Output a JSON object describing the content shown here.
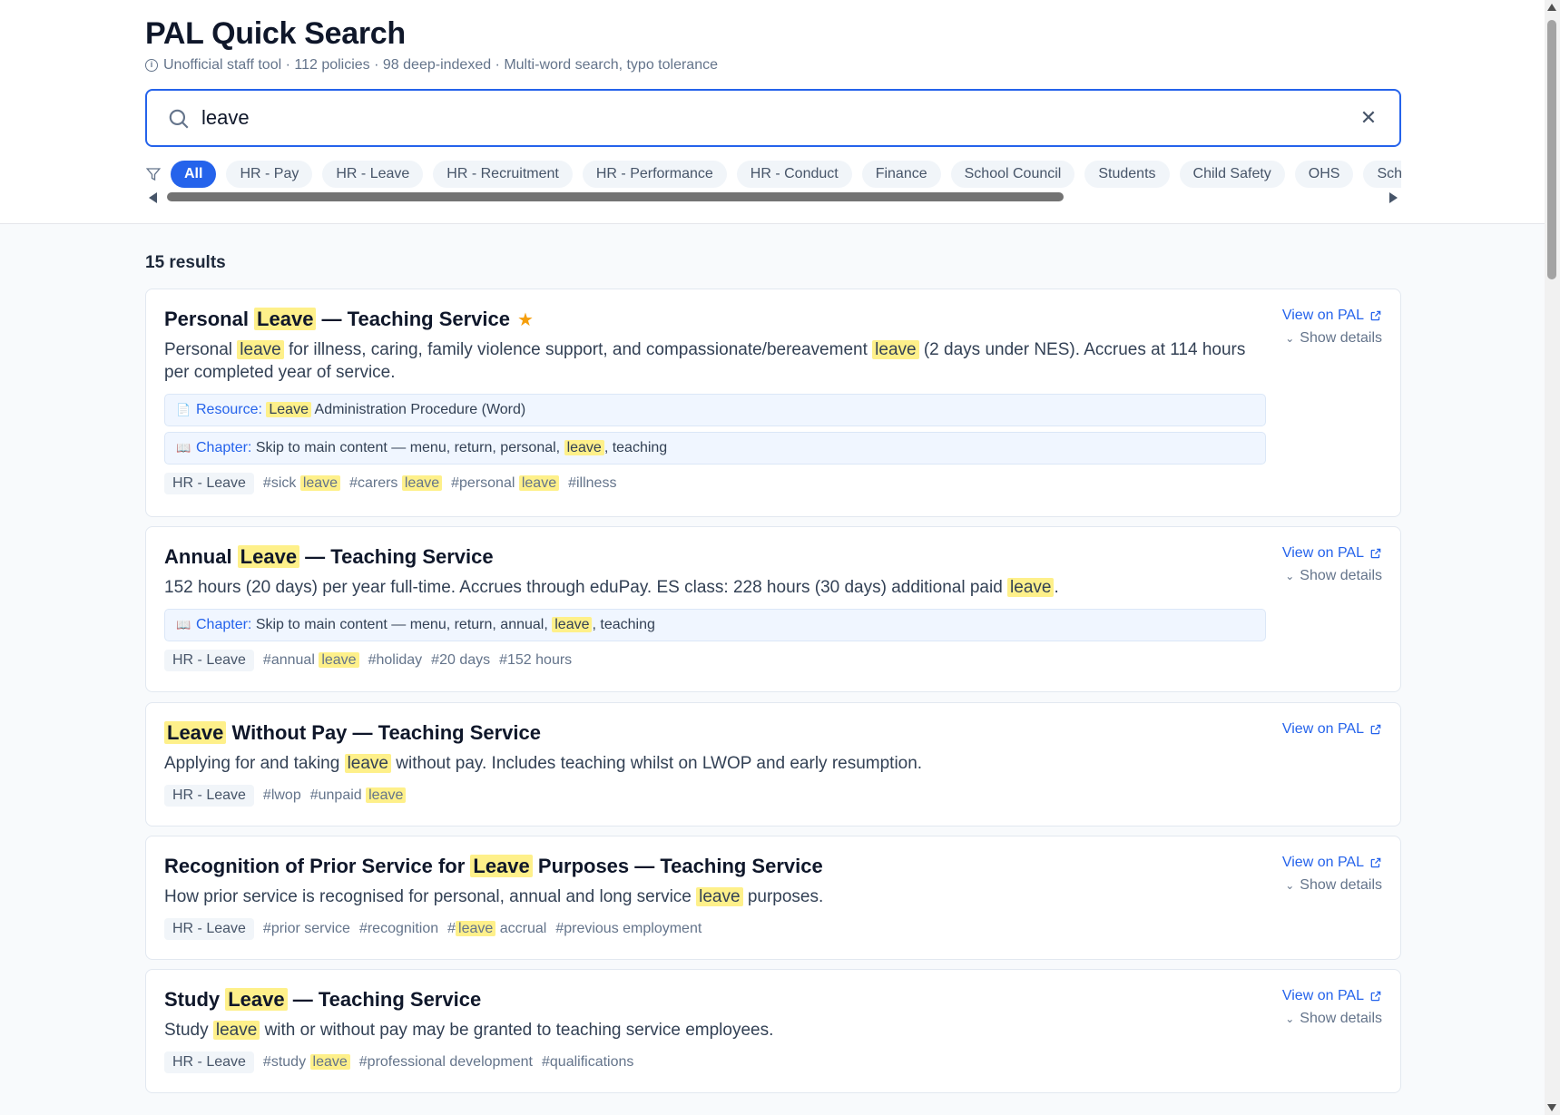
{
  "header": {
    "title": "PAL Quick Search",
    "subtitle": "Unofficial staff tool · 112 policies · 98 deep-indexed · Multi-word search, typo tolerance"
  },
  "search": {
    "value": "leave",
    "placeholder": ""
  },
  "filters": [
    {
      "label": "All",
      "active": true
    },
    {
      "label": "HR - Pay",
      "active": false
    },
    {
      "label": "HR - Leave",
      "active": false
    },
    {
      "label": "HR - Recruitment",
      "active": false
    },
    {
      "label": "HR - Performance",
      "active": false
    },
    {
      "label": "HR - Conduct",
      "active": false
    },
    {
      "label": "Finance",
      "active": false
    },
    {
      "label": "School Council",
      "active": false
    },
    {
      "label": "Students",
      "active": false
    },
    {
      "label": "Child Safety",
      "active": false
    },
    {
      "label": "OHS",
      "active": false
    },
    {
      "label": "Schoo",
      "active": false
    }
  ],
  "results_count": "15 results",
  "actions": {
    "view_label": "View on PAL",
    "details_label": "Show details"
  },
  "labels": {
    "resource": "Resource:",
    "chapter": "Chapter:"
  },
  "colors": {
    "accent": "#2563eb",
    "highlight": "#fef08a",
    "star": "#f59e0b"
  },
  "results": [
    {
      "title_parts": [
        "Personal ",
        "Leave",
        " — Teaching Service"
      ],
      "starred": true,
      "desc_parts": [
        "Personal ",
        "leave",
        " for illness, caring, family violence support, and compassionate/bereavement ",
        "leave",
        " (2 days under NES). Accrues at 114 hours per completed year of service."
      ],
      "resource_parts": [
        "",
        "Leave",
        " Administration Procedure (Word)"
      ],
      "chapter_parts": [
        "Skip to main content — menu, return, personal, ",
        "leave",
        ", teaching"
      ],
      "category": "HR - Leave",
      "tags": [
        [
          "#sick ",
          "leave"
        ],
        [
          "#carers ",
          "leave"
        ],
        [
          "#personal ",
          "leave"
        ],
        [
          "#illness",
          ""
        ]
      ],
      "has_details": true
    },
    {
      "title_parts": [
        "Annual ",
        "Leave",
        " — Teaching Service"
      ],
      "starred": false,
      "desc_parts": [
        "152 hours (20 days) per year full-time. Accrues through eduPay. ES class: 228 hours (30 days) additional paid ",
        "leave",
        "."
      ],
      "resource_parts": null,
      "chapter_parts": [
        "Skip to main content — menu, return, annual, ",
        "leave",
        ", teaching"
      ],
      "category": "HR - Leave",
      "tags": [
        [
          "#annual ",
          "leave"
        ],
        [
          "#holiday",
          ""
        ],
        [
          "#20 days",
          ""
        ],
        [
          "#152 hours",
          ""
        ]
      ],
      "has_details": true
    },
    {
      "title_parts": [
        "",
        "Leave",
        " Without Pay — Teaching Service"
      ],
      "starred": false,
      "desc_parts": [
        "Applying for and taking ",
        "leave",
        " without pay. Includes teaching whilst on LWOP and early resumption."
      ],
      "resource_parts": null,
      "chapter_parts": null,
      "category": "HR - Leave",
      "tags": [
        [
          "#lwop",
          ""
        ],
        [
          "#unpaid ",
          "leave"
        ]
      ],
      "has_details": false
    },
    {
      "title_parts": [
        "Recognition of Prior Service for ",
        "Leave",
        " Purposes — Teaching Service"
      ],
      "starred": false,
      "desc_parts": [
        "How prior service is recognised for personal, annual and long service ",
        "leave",
        " purposes."
      ],
      "resource_parts": null,
      "chapter_parts": null,
      "category": "HR - Leave",
      "tags": [
        [
          "#prior service",
          ""
        ],
        [
          "#recognition",
          ""
        ],
        [
          "#",
          "leave",
          " accrual"
        ],
        [
          "#previous employment",
          ""
        ]
      ],
      "has_details": true
    },
    {
      "title_parts": [
        "Study ",
        "Leave",
        " — Teaching Service"
      ],
      "starred": false,
      "desc_parts": [
        "Study ",
        "leave",
        " with or without pay may be granted to teaching service employees."
      ],
      "resource_parts": null,
      "chapter_parts": null,
      "category": "HR - Leave",
      "tags": [
        [
          "#study ",
          "leave"
        ],
        [
          "#professional development",
          ""
        ],
        [
          "#qualifications",
          ""
        ]
      ],
      "has_details": true
    }
  ]
}
